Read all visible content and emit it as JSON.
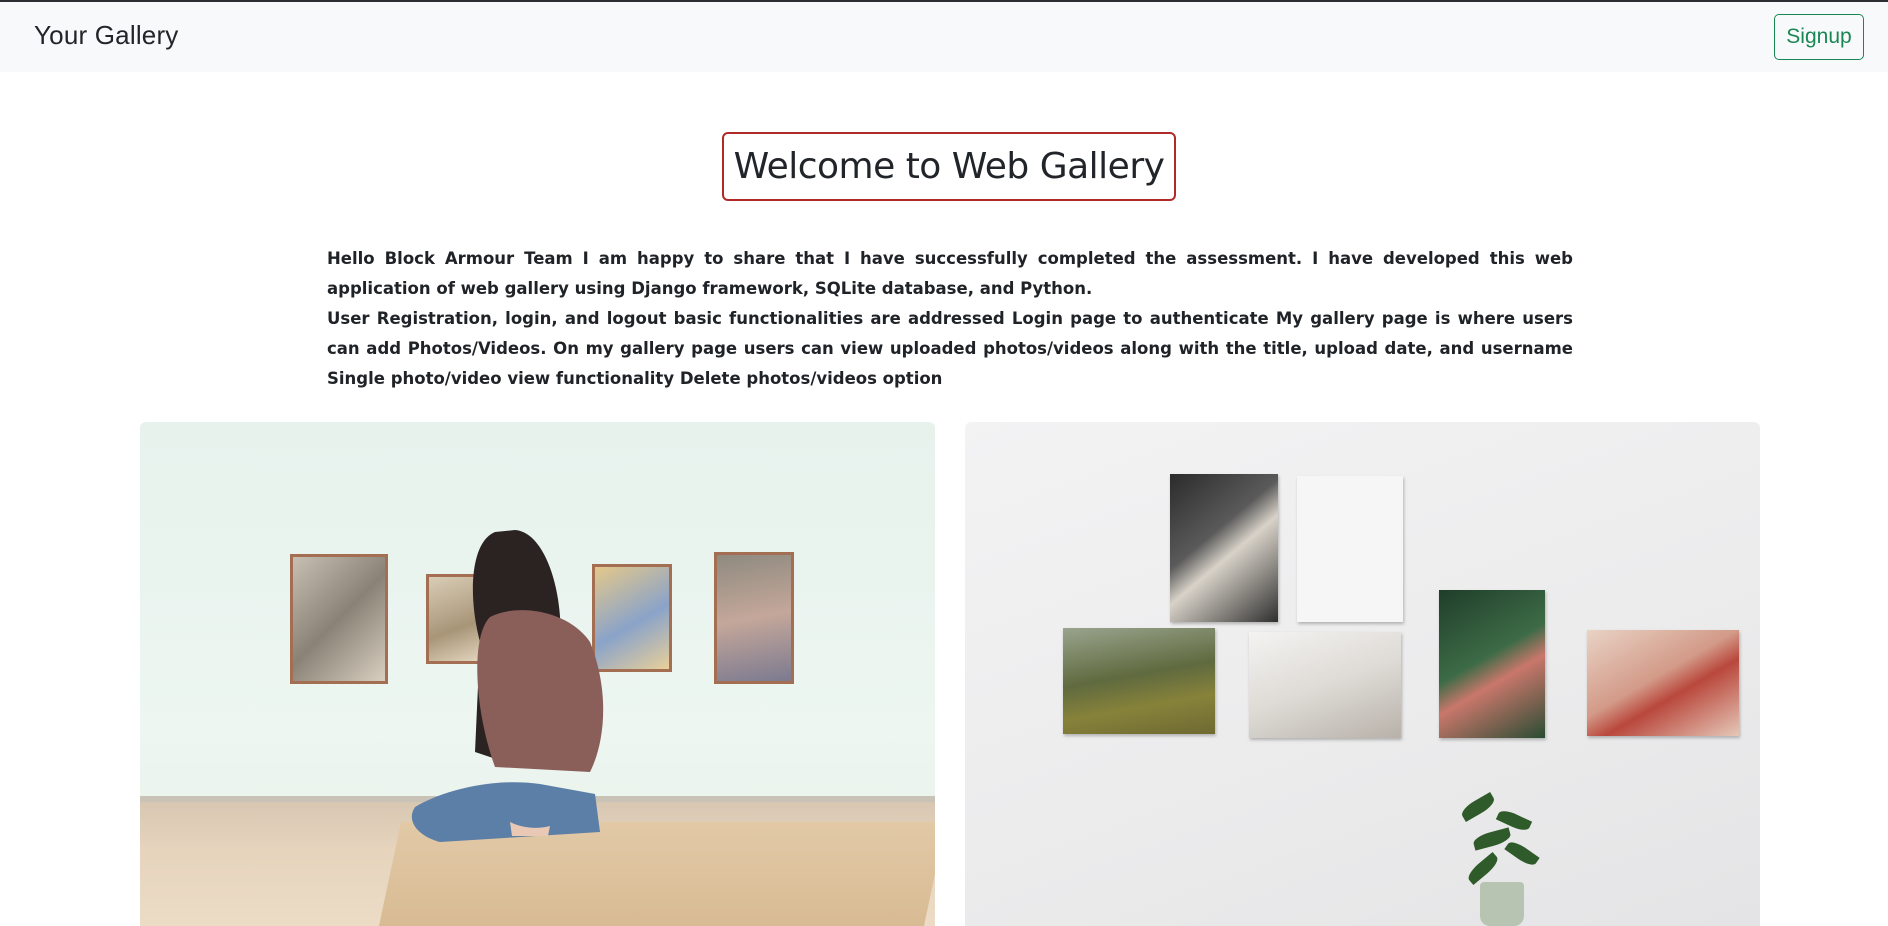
{
  "navbar": {
    "brand": "Your Gallery",
    "signup_label": "Signup"
  },
  "main": {
    "title": "Welcome to Web Gallery",
    "intro_paragraph_1": "Hello Block Armour Team I am happy to share that I have successfully completed the assessment. I have developed this web application of web gallery using Django framework, SQLite database, and Python.",
    "intro_paragraph_2": "User Registration, login, and logout basic functionalities are addressed Login page to authenticate My gallery page is where users can add Photos/Videos. On my gallery page users can view uploaded photos/videos along with the title, upload date, and username Single photo/video view functionality Delete photos/videos option"
  },
  "colors": {
    "signup_accent": "#198754",
    "title_border": "#b02a2a",
    "navbar_bg": "#f8f9fa"
  }
}
